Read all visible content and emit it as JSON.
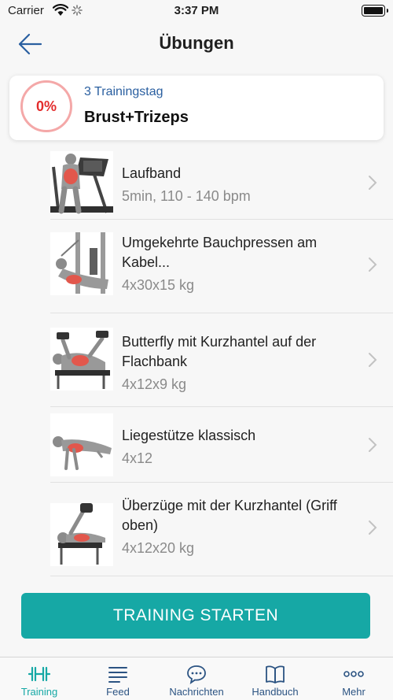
{
  "status_bar": {
    "carrier": "Carrier",
    "time": "3:37 PM"
  },
  "nav": {
    "title": "Übungen"
  },
  "training_day": {
    "progress": "0%",
    "day_label": "3 Trainingstag",
    "day_name": "Brust+Trizeps"
  },
  "exercises": [
    {
      "name": "Laufband",
      "detail": "5min, 110 - 140 bpm"
    },
    {
      "name": "Umgekehrte Bauchpressen am Kabel...",
      "detail": "4x30x15 kg"
    },
    {
      "name": "Butterfly mit Kurzhantel auf der Flachbank",
      "detail": "4x12x9 kg"
    },
    {
      "name": "Liegestütze klassisch",
      "detail": "4x12"
    },
    {
      "name": "Überzüge mit der Kurzhantel (Griff oben)",
      "detail": "4x12x20 kg"
    }
  ],
  "start_button": "TRAINING STARTEN",
  "tabs": [
    {
      "label": "Training",
      "icon": "dumbbell-icon",
      "active": true
    },
    {
      "label": "Feed",
      "icon": "feed-icon"
    },
    {
      "label": "Nachrichten",
      "icon": "chat-icon"
    },
    {
      "label": "Handbuch",
      "icon": "book-icon"
    },
    {
      "label": "Mehr",
      "icon": "more-icon"
    }
  ],
  "colors": {
    "accent": "#16a8a5",
    "progress": "#e32c2c",
    "link": "#2a5fa0",
    "tab": "#2b5382"
  }
}
